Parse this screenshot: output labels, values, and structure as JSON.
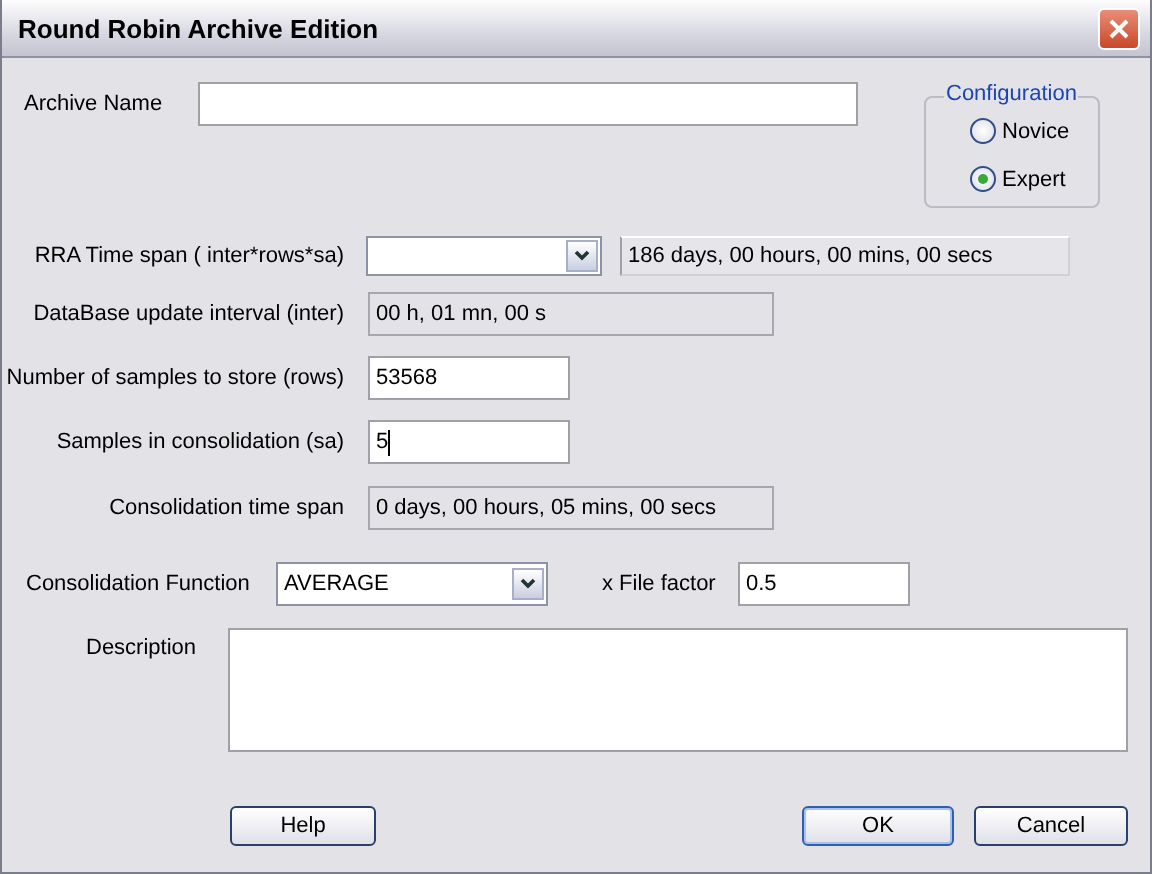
{
  "window": {
    "title": "Round Robin Archive Edition"
  },
  "archive_name": {
    "label": "Archive Name"
  },
  "configuration": {
    "legend": "Configuration",
    "options": [
      {
        "label": "Novice",
        "selected": false
      },
      {
        "label": "Expert",
        "selected": true
      }
    ]
  },
  "rows": [
    {
      "label": "RRA Time span  ( inter*rows*sa)",
      "kind": "combo",
      "readout": "186 days, 00 hours, 00 mins, 00 secs"
    },
    {
      "label": "DataBase update interval (inter)",
      "kind": "readonly",
      "value": "00 h, 01 mn, 00 s"
    },
    {
      "label": "Number of samples to store (rows)",
      "kind": "input",
      "value": "53568"
    },
    {
      "label": "Samples in consolidation (sa)",
      "kind": "input",
      "value": "5",
      "focused": true
    },
    {
      "label": "Consolidation time span",
      "kind": "readonly",
      "value": "0 days, 00 hours, 05 mins, 00 secs"
    }
  ],
  "consolidation_function": {
    "label": "Consolidation Function",
    "value": "AVERAGE"
  },
  "file_factor": {
    "label": "x File factor",
    "value": "0.5"
  },
  "description": {
    "label": "Description"
  },
  "buttons": [
    {
      "label": "Help",
      "default": false
    },
    {
      "label": "OK",
      "default": true
    },
    {
      "label": "Cancel",
      "default": false
    }
  ]
}
